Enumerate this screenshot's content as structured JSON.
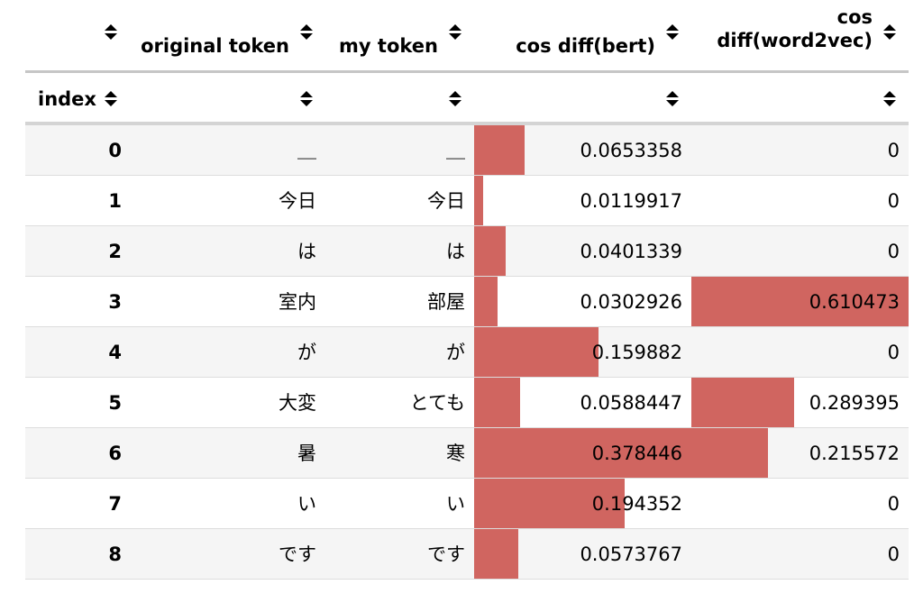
{
  "table": {
    "headers": {
      "original_token": "original token",
      "my_token": "my token",
      "cos_diff_bert": "cos diff(bert)",
      "cos_diff_w2v_line1": "cos",
      "cos_diff_w2v_line2": "diff(word2vec)",
      "index_label": "index"
    },
    "bar_color": "#d06560",
    "bert_scale_max": 0.378446,
    "w2v_scale_max": 0.610473,
    "rows": [
      {
        "index": "0",
        "original": "＿",
        "mine": "＿",
        "bert": "0.0653358",
        "w2v": "0"
      },
      {
        "index": "1",
        "original": "今日",
        "mine": "今日",
        "bert": "0.0119917",
        "w2v": "0"
      },
      {
        "index": "2",
        "original": "は",
        "mine": "は",
        "bert": "0.0401339",
        "w2v": "0"
      },
      {
        "index": "3",
        "original": "室内",
        "mine": "部屋",
        "bert": "0.0302926",
        "w2v": "0.610473"
      },
      {
        "index": "4",
        "original": "が",
        "mine": "が",
        "bert": "0.159882",
        "w2v": "0"
      },
      {
        "index": "5",
        "original": "大変",
        "mine": "とても",
        "bert": "0.0588447",
        "w2v": "0.289395"
      },
      {
        "index": "6",
        "original": "暑",
        "mine": "寒",
        "bert": "0.378446",
        "w2v": "0.215572"
      },
      {
        "index": "7",
        "original": "い",
        "mine": "い",
        "bert": "0.194352",
        "w2v": "0"
      },
      {
        "index": "8",
        "original": "です",
        "mine": "です",
        "bert": "0.0573767",
        "w2v": "0"
      }
    ]
  }
}
